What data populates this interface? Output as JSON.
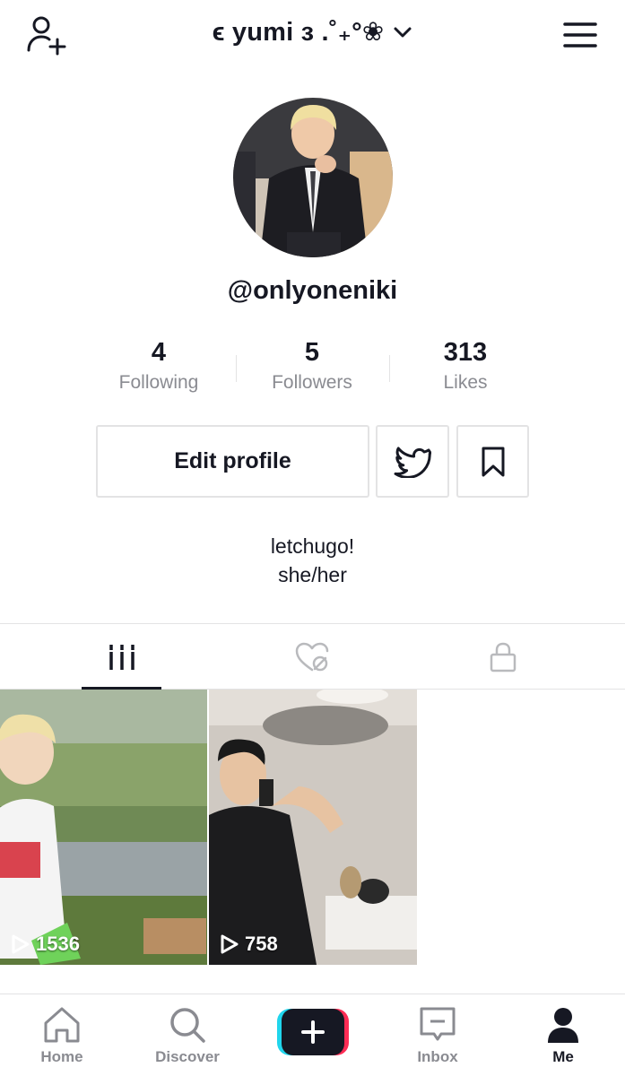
{
  "header": {
    "title": "ϵ yumi з .˚₊°❀",
    "title_icons": [
      "add-user-icon",
      "chevron-down-icon",
      "hamburger-menu-icon"
    ]
  },
  "profile": {
    "username": "@onlyoneniki",
    "bio_line1": "letchugo!",
    "bio_line2": "she/her"
  },
  "stats": [
    {
      "value": "4",
      "label": "Following"
    },
    {
      "value": "5",
      "label": "Followers"
    },
    {
      "value": "313",
      "label": "Likes"
    }
  ],
  "actions": {
    "edit_profile": "Edit profile",
    "twitter_icon": "twitter-icon",
    "bookmark_icon": "bookmark-icon"
  },
  "tabs": [
    {
      "icon": "videos-grid-icon",
      "active": true
    },
    {
      "icon": "liked-hidden-icon",
      "active": false
    },
    {
      "icon": "lock-icon",
      "active": false
    }
  ],
  "videos": [
    {
      "views": "1536"
    },
    {
      "views": "758"
    }
  ],
  "nav": [
    {
      "label": "Home",
      "icon": "home-icon"
    },
    {
      "label": "Discover",
      "icon": "search-icon"
    },
    {
      "label": "",
      "icon": "create-plus-icon"
    },
    {
      "label": "Inbox",
      "icon": "inbox-icon"
    },
    {
      "label": "Me",
      "icon": "profile-icon",
      "active": true
    }
  ],
  "colors": {
    "text": "#161823",
    "muted": "#8a8b91",
    "border": "#e3e3e4",
    "plus_cyan": "#20d5ec",
    "plus_pink": "#fe2c55"
  }
}
